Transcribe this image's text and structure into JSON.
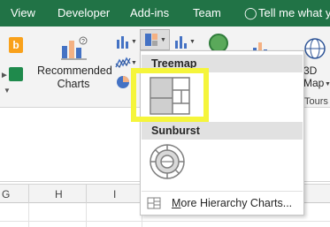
{
  "tabs": {
    "view": "View",
    "developer": "Developer",
    "addins": "Add-ins",
    "team": "Team"
  },
  "tell_me": {
    "icon": "lightbulb-icon",
    "text": "Tell me what yo"
  },
  "ribbon": {
    "recommended_charts_line1": "Recommended",
    "recommended_charts_line2": "Charts",
    "map3d_line1": "3D",
    "map3d_line2": "Map",
    "tours_label": "Tours",
    "bing_glyph": "b"
  },
  "dropdown": {
    "treemap_header": "Treemap",
    "sunburst_header": "Sunburst",
    "more_prefix": "M",
    "more_rest": "ore Hierarchy Charts..."
  },
  "columns": [
    "G",
    "H",
    "I"
  ],
  "colors": {
    "ribbon_tab_green": "#217346",
    "highlight_yellow": "#f5f53b"
  }
}
